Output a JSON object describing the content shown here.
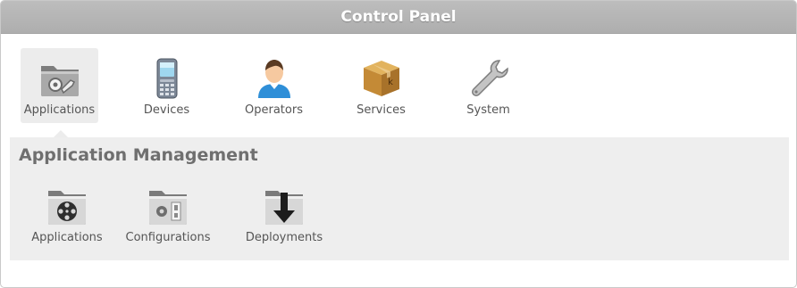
{
  "header": {
    "title": "Control Panel"
  },
  "tabs": [
    {
      "label": "Applications",
      "icon": "folder-gear-icon",
      "active": true
    },
    {
      "label": "Devices",
      "icon": "mobile-phone-icon",
      "active": false
    },
    {
      "label": "Operators",
      "icon": "user-icon",
      "active": false
    },
    {
      "label": "Services",
      "icon": "package-box-icon",
      "active": false
    },
    {
      "label": "System",
      "icon": "wrench-icon",
      "active": false
    }
  ],
  "section": {
    "title": "Application Management",
    "items": [
      {
        "label": "Applications",
        "icon": "film-reel-folder-icon"
      },
      {
        "label": "Configurations",
        "icon": "settings-folder-icon"
      },
      {
        "label": "Deployments",
        "icon": "download-folder-icon"
      }
    ]
  },
  "colors": {
    "titlebar": "#b3b3b3",
    "active_tab": "#ececec",
    "section_bg": "#eeeeee",
    "section_title": "#6f6f6f",
    "label_text": "#555555"
  }
}
